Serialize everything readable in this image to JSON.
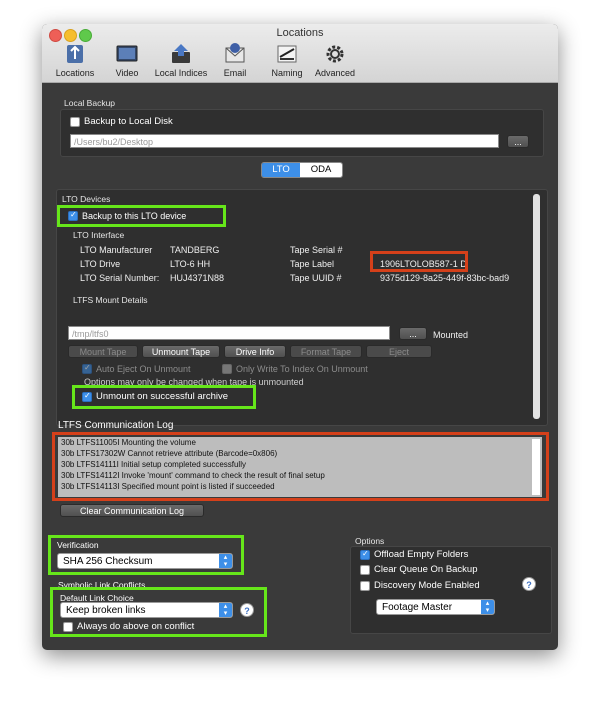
{
  "window": {
    "title": "Locations"
  },
  "toolbar": {
    "items": [
      {
        "label": "Locations",
        "icon": "locations-icon"
      },
      {
        "label": "Video",
        "icon": "video-icon"
      },
      {
        "label": "Local Indices",
        "icon": "local-indices-icon"
      },
      {
        "label": "Email",
        "icon": "email-icon"
      },
      {
        "label": "Naming",
        "icon": "naming-icon"
      },
      {
        "label": "Advanced",
        "icon": "advanced-gear-icon"
      }
    ]
  },
  "local_backup": {
    "section_label": "Local Backup",
    "checkbox_label": "Backup to Local Disk",
    "checked": false,
    "path_value": "/Users/bu2/Desktop",
    "browse_label": "..."
  },
  "mode_toggle": {
    "options": [
      "LTO",
      "ODA"
    ],
    "selected": "LTO"
  },
  "lto_devices": {
    "section_label": "LTO Devices",
    "backup_checkbox_label": "Backup to this LTO device",
    "backup_checked": true,
    "interface_label": "LTO Interface",
    "manufacturer_label": "LTO Manufacturer",
    "manufacturer_value": "TANDBERG",
    "drive_label": "LTO Drive",
    "drive_value": "LTO-6 HH",
    "serial_label": "LTO Serial Number:",
    "serial_value": "HUJ4371N88",
    "tape_serial_label": "Tape Serial #",
    "tape_serial_value": "",
    "tape_label_label": "Tape Label",
    "tape_label_value": "1906LTOLOB587-1 D",
    "tape_uuid_label": "Tape UUID #",
    "tape_uuid_value": "9375d129-8a25-449f-83bc-bad9"
  },
  "ltfs_mount": {
    "section_label": "LTFS Mount Details",
    "path_value": "/tmp/ltfs0",
    "browse_label": "...",
    "status": "Mounted",
    "buttons": {
      "mount_tape": "Mount Tape",
      "unmount_tape": "Unmount Tape",
      "drive_info": "Drive Info",
      "format_tape": "Format Tape",
      "eject": "Eject"
    },
    "auto_eject_label": "Auto Eject On Unmount",
    "only_write_label": "Only Write To Index On Unmount",
    "note": "Options may only be changed when tape is unmounted",
    "unmount_on_archive_label": "Unmount on successful archive",
    "unmount_on_archive_checked": true
  },
  "comm_log": {
    "title": "LTFS Communication Log",
    "lines": [
      "30b LTFS11005I Mounting the volume",
      "30b LTFS17302W Cannot retrieve attribute (Barcode=0x806)",
      "30b LTFS14111I Initial setup completed successfully",
      "30b LTFS14112I Invoke 'mount' command to check the result of final setup",
      "30b LTFS14113I Specified mount point is listed if succeeded"
    ],
    "clear_button_label": "Clear Communication Log"
  },
  "verification": {
    "section_label": "Verification",
    "selected": "SHA 256 Checksum"
  },
  "symlink": {
    "section_label": "Symbolic Link Conflicts",
    "default_label": "Default Link Choice",
    "selected": "Keep broken links",
    "always_do_label": "Always do above on conflict",
    "always_do_checked": false,
    "help_label": "?"
  },
  "options": {
    "section_label": "Options",
    "offload_empty_label": "Offload Empty Folders",
    "offload_empty_checked": true,
    "clear_queue_label": "Clear Queue On Backup",
    "clear_queue_checked": false,
    "discovery_label": "Discovery Mode Enabled",
    "discovery_checked": false,
    "help_label": "?",
    "preset_selected": "Footage Master"
  },
  "colors": {
    "highlight_green": "#66e61a",
    "highlight_red": "#d5401a",
    "accent_blue": "#3d8fe8"
  }
}
